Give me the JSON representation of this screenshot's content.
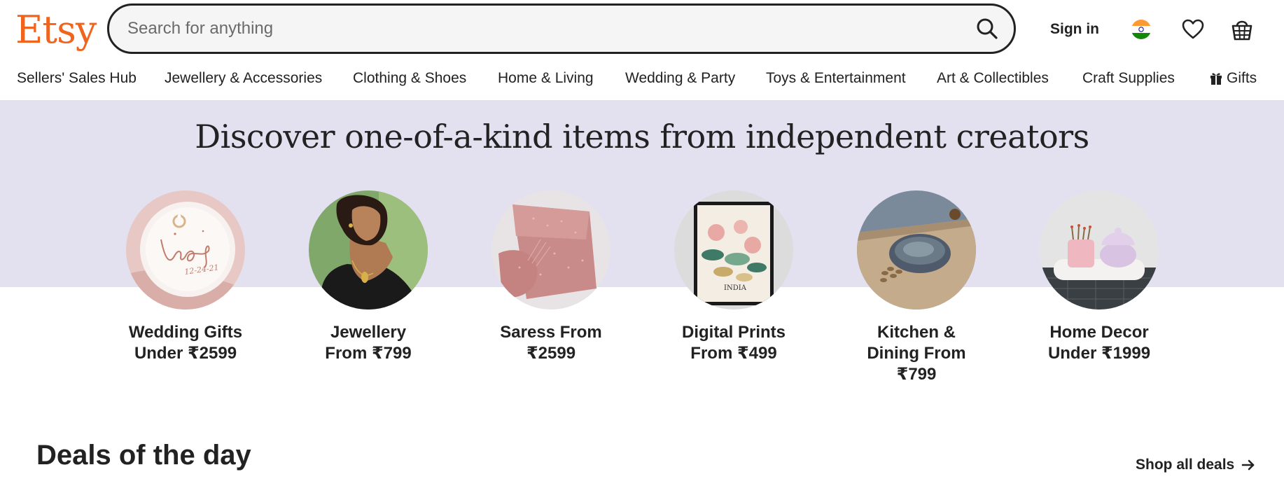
{
  "header": {
    "logo": "Etsy",
    "search_placeholder": "Search for anything",
    "sign_in": "Sign in",
    "icons": [
      "search-icon",
      "india-flag-icon",
      "heart-icon",
      "basket-icon"
    ],
    "brand_color": "#F1641E"
  },
  "nav": {
    "items": [
      {
        "label": "Sellers' Sales Hub"
      },
      {
        "label": "Jewellery & Accessories"
      },
      {
        "label": "Clothing & Shoes"
      },
      {
        "label": "Home & Living"
      },
      {
        "label": "Wedding & Party"
      },
      {
        "label": "Toys & Entertainment"
      },
      {
        "label": "Art & Collectibles"
      },
      {
        "label": "Craft Supplies"
      },
      {
        "label": "Gifts",
        "icon": "gift-icon"
      }
    ]
  },
  "hero": {
    "title": "Discover one-of-a-kind items from independent creators",
    "band_color": "#e3e0f0",
    "categories": [
      {
        "line1": "Wedding Gifts",
        "line2": "Under ₹2599",
        "line3": ""
      },
      {
        "line1": "Jewellery",
        "line2": "From ₹799",
        "line3": ""
      },
      {
        "line1": "Saress From",
        "line2": "₹2599",
        "line3": ""
      },
      {
        "line1": "Digital Prints",
        "line2": "From ₹499",
        "line3": ""
      },
      {
        "line1": "Kitchen &",
        "line2": "Dining From",
        "line3": "₹799"
      },
      {
        "line1": "Home Decor",
        "line2": "Under ₹1999",
        "line3": ""
      }
    ],
    "print_text": "INDIA"
  },
  "deals": {
    "title": "Deals of the day",
    "shop_all": "Shop all deals"
  }
}
